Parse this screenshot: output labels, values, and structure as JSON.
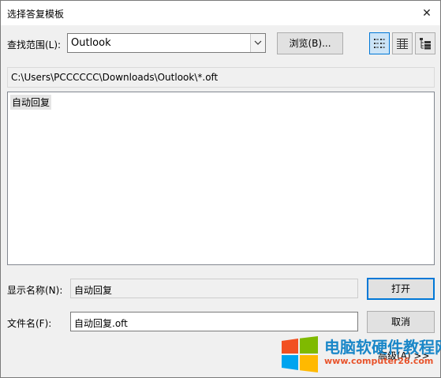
{
  "window": {
    "title": "选择答复模板",
    "close_glyph": "✕"
  },
  "lookin": {
    "label": "查找范围(L):",
    "value": "Outlook",
    "browse_label": "浏览(B)..."
  },
  "views": [
    {
      "name": "list-view-icon",
      "active": true
    },
    {
      "name": "details-view-icon",
      "active": false
    },
    {
      "name": "tree-view-icon",
      "active": false
    }
  ],
  "path": "C:\\Users\\PCCCCCC\\Downloads\\Outlook\\*.oft",
  "files": [
    {
      "label": "自动回复"
    }
  ],
  "display_name": {
    "label": "显示名称(N):",
    "value": "自动回复"
  },
  "file_name": {
    "label": "文件名(F):",
    "value": "自动回复.oft"
  },
  "buttons": {
    "open": "打开",
    "cancel": "取消",
    "advanced": "高级(A) >>"
  },
  "watermark": {
    "title": "电脑软硬件教程网",
    "url": "www.computer26.com"
  }
}
